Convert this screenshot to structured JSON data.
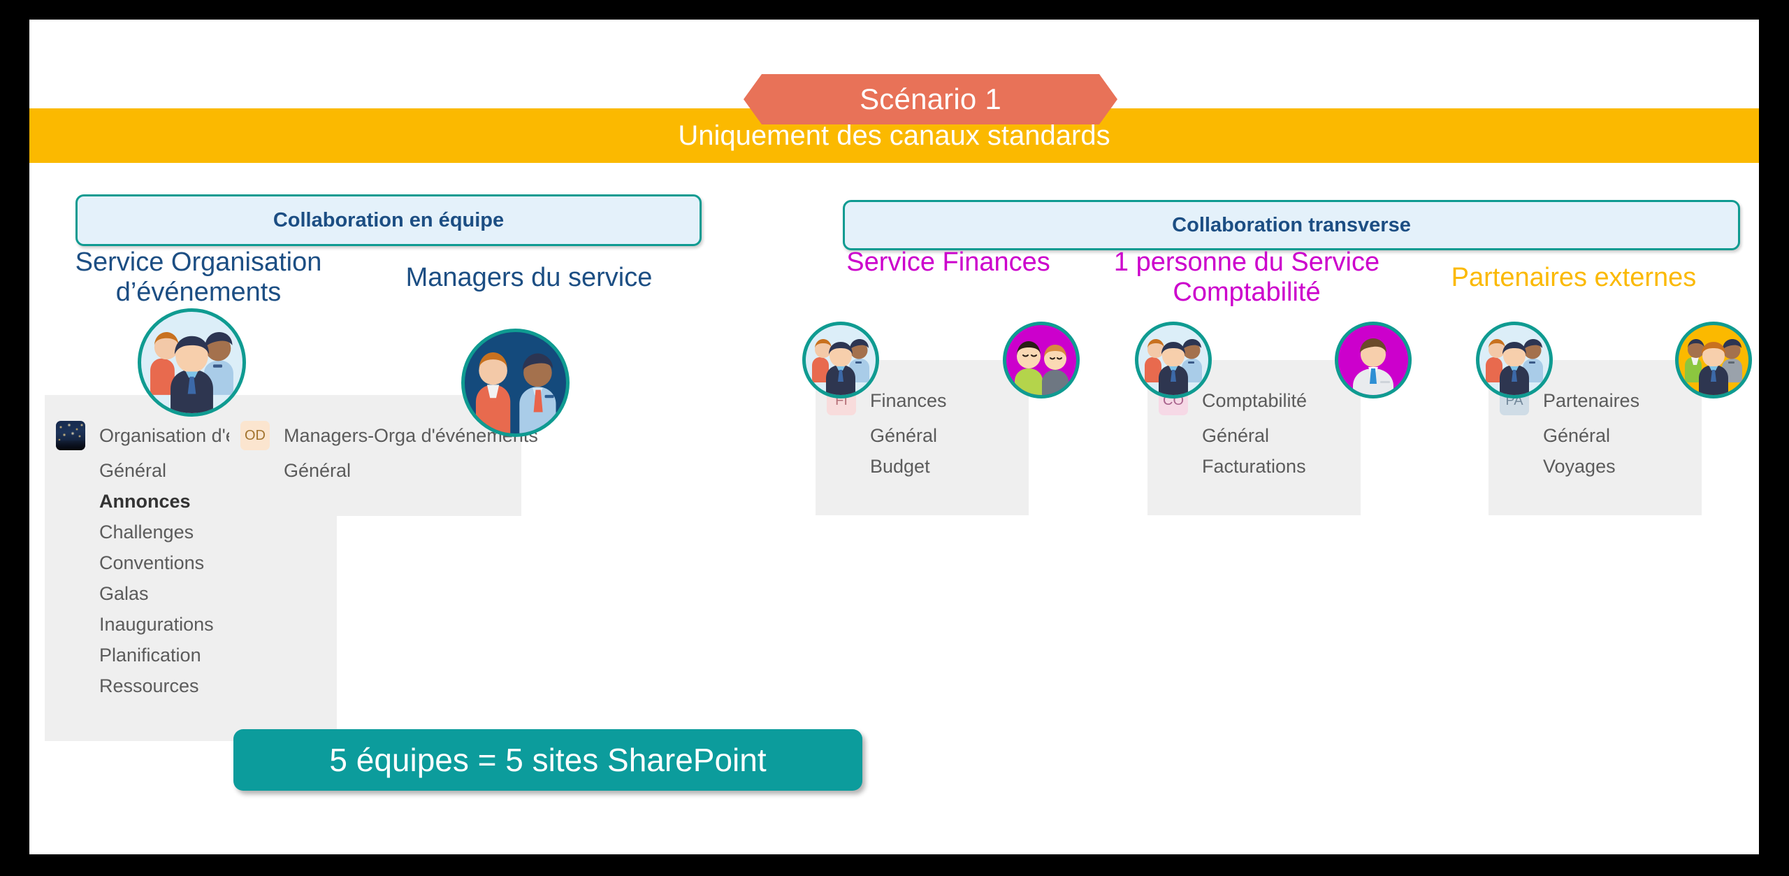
{
  "scenario": {
    "label": "Scénario 1"
  },
  "banner_top": {
    "text": "Uniquement des canaux standards"
  },
  "sections": {
    "team": {
      "title": "Collaboration en équipe"
    },
    "cross": {
      "title": "Collaboration transverse"
    }
  },
  "columns": [
    {
      "title": "Service Organisation d’événements",
      "title_line1": "Service Organisation",
      "title_line2": "d’événements",
      "title_color": "#1C4E83",
      "avatar_main": "team-avatar-icon",
      "avatar_secondary": null,
      "team": {
        "name": "Organisation d'événements",
        "tile": "photo",
        "initials": ""
      },
      "channels": [
        {
          "label": "Général",
          "active": false
        },
        {
          "label": "Annonces",
          "active": true
        },
        {
          "label": "Challenges",
          "active": false
        },
        {
          "label": "Conventions",
          "active": false
        },
        {
          "label": "Galas",
          "active": false
        },
        {
          "label": "Inaugurations",
          "active": false
        },
        {
          "label": "Planification",
          "active": false
        },
        {
          "label": "Ressources",
          "active": false
        }
      ]
    },
    {
      "title": "Managers du service",
      "title_line1": "Managers du service",
      "title_line2": "",
      "title_color": "#1C4E83",
      "avatar_main": "managers-avatar-icon",
      "avatar_secondary": null,
      "team": {
        "name": "Managers-Orga d'événements",
        "tile": "initials",
        "initials": "OD"
      },
      "channels": [
        {
          "label": "Général",
          "active": false
        }
      ]
    },
    {
      "title": "Service Finances",
      "title_line1": "Service Finances",
      "title_line2": "",
      "title_color": "#CC00CC",
      "avatar_main": "team-avatar-icon",
      "avatar_secondary": "guests-avatar-icon",
      "team": {
        "name": "Finances",
        "tile": "initials",
        "initials": "FI"
      },
      "channels": [
        {
          "label": "Général",
          "active": false
        },
        {
          "label": "Budget",
          "active": false
        }
      ]
    },
    {
      "title": "1 personne du Service Comptabilité",
      "title_line1": "1 personne du Service",
      "title_line2": "Comptabilité",
      "title_color": "#CC00CC",
      "avatar_main": "team-avatar-icon",
      "avatar_secondary": "single-person-avatar-icon",
      "team": {
        "name": "Comptabilité",
        "tile": "initials",
        "initials": "CO"
      },
      "channels": [
        {
          "label": "Général",
          "active": false
        },
        {
          "label": "Facturations",
          "active": false
        }
      ]
    },
    {
      "title": "Partenaires externes",
      "title_line1": "Partenaires externes",
      "title_line2": "",
      "title_color": "#FBB900",
      "avatar_main": "team-avatar-icon",
      "avatar_secondary": "external-partners-avatar-icon",
      "team": {
        "name": "Partenaires",
        "tile": "initials",
        "initials": "PA"
      },
      "channels": [
        {
          "label": "Général",
          "active": false
        },
        {
          "label": "Voyages",
          "active": false
        }
      ]
    }
  ],
  "banner_bottom": {
    "text": "5 équipes = 5 sites SharePoint"
  },
  "colors": {
    "accent_teal": "#0C9C9C",
    "band_yellow": "#FBB900",
    "tag_orange": "#E87258",
    "title_blue": "#1C4E83",
    "magenta": "#CC00CC",
    "card_gray": "#EFEFEF"
  }
}
